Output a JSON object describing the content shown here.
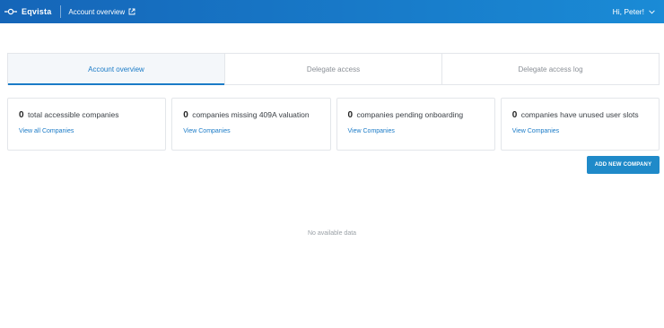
{
  "header": {
    "brand": "Eqvista",
    "page_link": "Account overview",
    "greeting": "Hi, Peter!"
  },
  "tabs": [
    {
      "label": "Account overview",
      "active": true
    },
    {
      "label": "Delegate access",
      "active": false
    },
    {
      "label": "Delegate access log",
      "active": false
    }
  ],
  "cards": [
    {
      "count": "0",
      "label": "total accessible companies",
      "link": "View all Companies"
    },
    {
      "count": "0",
      "label": "companies missing 409A valuation",
      "link": "View Companies"
    },
    {
      "count": "0",
      "label": "companies pending onboarding",
      "link": "View Companies"
    },
    {
      "count": "0",
      "label": "companies have unused user slots",
      "link": "View Companies"
    }
  ],
  "actions": {
    "add_company": "ADD NEW COMPANY"
  },
  "empty_state": "No available data",
  "colors": {
    "accent": "#1b7bc7",
    "button": "#1f8ac9",
    "header_start": "#1565b8",
    "header_end": "#1a8bd6"
  },
  "icons": {
    "logo": "eqvista-logo-icon",
    "external": "external-link-icon",
    "dropdown": "chevron-down-icon"
  }
}
